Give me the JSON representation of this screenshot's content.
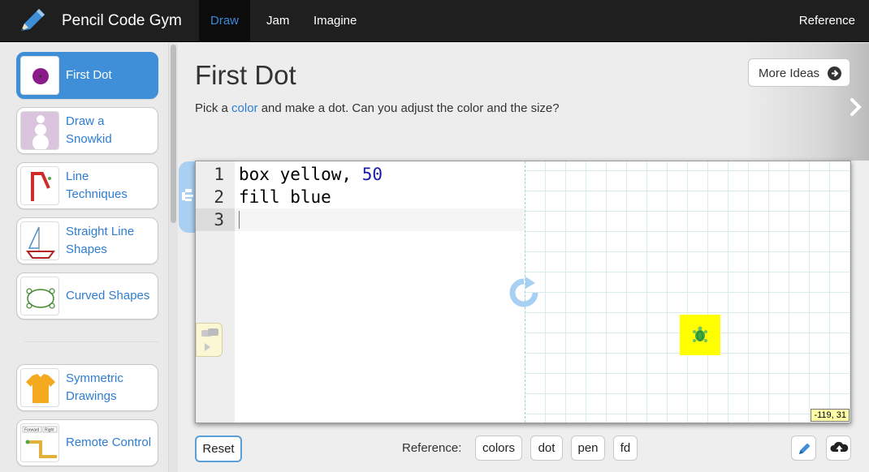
{
  "header": {
    "brand": "Pencil Code Gym",
    "tabs": [
      {
        "label": "Draw",
        "active": true
      },
      {
        "label": "Jam",
        "active": false
      },
      {
        "label": "Imagine",
        "active": false
      }
    ],
    "reference": "Reference",
    "icon": "pencil-icon"
  },
  "sidebar": {
    "items": [
      {
        "label": "First Dot",
        "active": true,
        "icon": "purple-dot-thumbnail"
      },
      {
        "label": "Draw a Snowkid",
        "active": false,
        "icon": "snowkid-thumbnail"
      },
      {
        "label": "Line Techniques",
        "active": false,
        "icon": "red-line-thumbnail"
      },
      {
        "label": "Straight Line Shapes",
        "active": false,
        "icon": "sailboat-thumbnail"
      },
      {
        "label": "Curved Shapes",
        "active": false,
        "icon": "curved-turtle-thumbnail"
      },
      {
        "label": "Symmetric Drawings",
        "active": false,
        "icon": "tshirt-thumbnail"
      },
      {
        "label": "Remote Control",
        "active": false,
        "icon": "remote-path-thumbnail"
      }
    ],
    "remote_thumb_text": [
      "Forward",
      "Right"
    ]
  },
  "main": {
    "title": "First Dot",
    "description_before": "Pick a ",
    "description_link": "color",
    "description_after": " and make a dot. Can you adjust the color and the size?",
    "more_ideas": "More Ideas"
  },
  "editor": {
    "line_numbers": [
      "1",
      "2",
      "3"
    ],
    "lines": [
      {
        "text": "box yellow, ",
        "number": "50"
      },
      {
        "text": "fill blue",
        "number": ""
      },
      {
        "text": "",
        "number": ""
      }
    ],
    "coords": "-119, 31"
  },
  "bottom": {
    "reset": "Reset",
    "reference_label": "Reference:",
    "chips": [
      "colors",
      "dot",
      "pen",
      "fd"
    ]
  },
  "colors": {
    "accent": "#3e8ed8",
    "topbar": "#1f1f1f",
    "link": "#2e7dd1",
    "canvas_fill": "#ffff00"
  }
}
